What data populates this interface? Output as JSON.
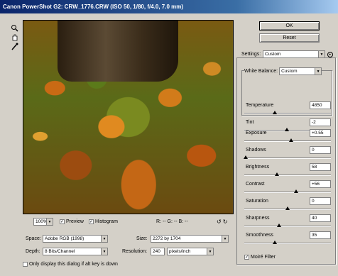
{
  "window": {
    "title": "Canon PowerShot G2: CRW_1776.CRW  (ISO 50, 1/80, f/4.0, 7.0 mm)"
  },
  "tools": [
    {
      "name": "zoom-icon",
      "glyph": "🔍"
    },
    {
      "name": "hand-icon",
      "glyph": "✋"
    },
    {
      "name": "eyedropper-icon",
      "glyph": "✎"
    }
  ],
  "buttons": {
    "ok": "OK",
    "reset": "Reset"
  },
  "settings": {
    "label": "Settings:",
    "value": "Custom"
  },
  "white_balance": {
    "label": "White Balance:",
    "value": "Custom"
  },
  "adjustments": [
    {
      "label": "Temperature",
      "value": "4850",
      "level": 0.35
    },
    {
      "label": "Tint",
      "value": "-2",
      "level": 0.49
    },
    {
      "label": "Exposure",
      "value": "+0.55",
      "level": 0.54
    },
    {
      "label": "Shadows",
      "value": "0",
      "level": 0.02
    },
    {
      "label": "Brightness",
      "value": "58",
      "level": 0.38
    },
    {
      "label": "Contrast",
      "value": "+56",
      "level": 0.6
    },
    {
      "label": "Saturation",
      "value": "0",
      "level": 0.5
    },
    {
      "label": "Sharpness",
      "value": "40",
      "level": 0.4
    },
    {
      "label": "Smoothness",
      "value": "35",
      "level": 0.35
    }
  ],
  "moire": {
    "label": "Moiré Filter",
    "checked": true
  },
  "zoom": {
    "value": "100%"
  },
  "preview_opts": {
    "preview_label": "Preview",
    "histogram_label": "Histogram",
    "rgb_readout": "R: --  G: --  B: --"
  },
  "space": {
    "label": "Space:",
    "value": "Adobe RGB (1998)"
  },
  "size": {
    "label": "Size:",
    "value": "2272 by 1704"
  },
  "depth": {
    "label": "Depth:",
    "value": "8 Bits/Channel"
  },
  "resolution": {
    "label": "Resolution:",
    "value": "240",
    "unit": "pixels/inch"
  },
  "alt_key": {
    "label": "Only display this dialog if alt key is down"
  }
}
